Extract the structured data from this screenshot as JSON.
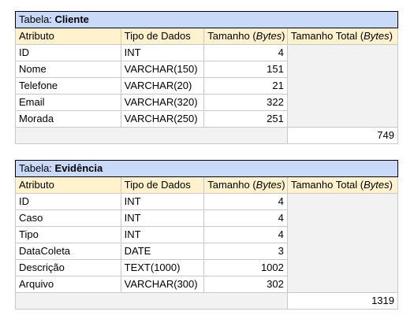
{
  "tables": [
    {
      "title_prefix": "Tabela: ",
      "title_name": "Cliente",
      "headers": [
        "Atributo",
        "Tipo de Dados",
        "Tamanho (",
        "Bytes",
        ")",
        "Tamanho Total (",
        "Bytes",
        ")"
      ],
      "rows": [
        {
          "attr": "ID",
          "type": "INT",
          "size": "4"
        },
        {
          "attr": "Nome",
          "type": "VARCHAR(150)",
          "size": "151"
        },
        {
          "attr": "Telefone",
          "type": "VARCHAR(20)",
          "size": "21"
        },
        {
          "attr": "Email",
          "type": "VARCHAR(320)",
          "size": "322"
        },
        {
          "attr": "Morada",
          "type": "VARCHAR(250)",
          "size": "251"
        }
      ],
      "total": "749"
    },
    {
      "title_prefix": "Tabela: ",
      "title_name": "Evidência",
      "headers": [
        "Atributo",
        "Tipo de Dados",
        "Tamanho (",
        "Bytes",
        ")",
        "Tamanho Total (",
        "Bytes",
        ")"
      ],
      "rows": [
        {
          "attr": "ID",
          "type": "INT",
          "size": "4"
        },
        {
          "attr": "Caso",
          "type": "INT",
          "size": "4"
        },
        {
          "attr": "Tipo",
          "type": "INT",
          "size": "4"
        },
        {
          "attr": "DataColeta",
          "type": "DATE",
          "size": "3"
        },
        {
          "attr": "Descrição",
          "type": "TEXT(1000)",
          "size": "1002"
        },
        {
          "attr": "Arquivo",
          "type": "VARCHAR(300)",
          "size": "302"
        }
      ],
      "total": "1319"
    }
  ]
}
